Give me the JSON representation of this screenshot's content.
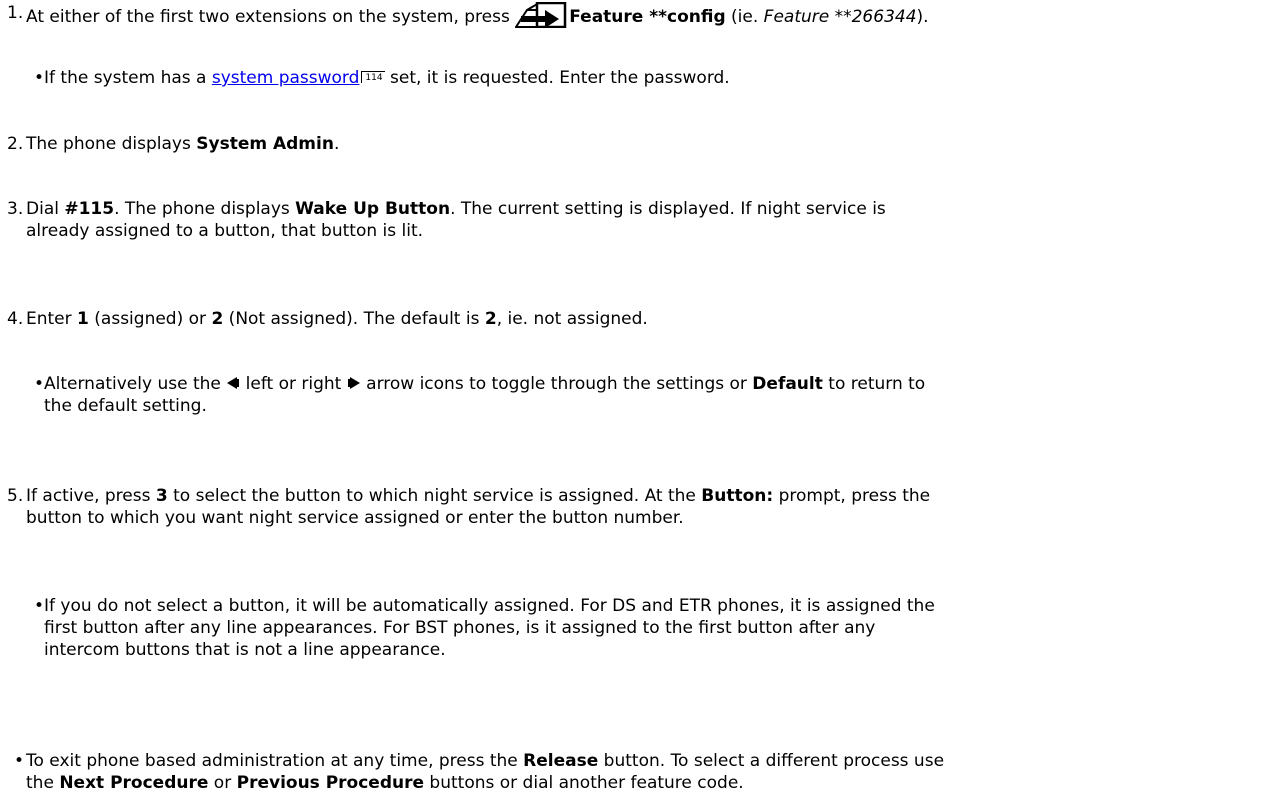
{
  "step1": {
    "num": "1.",
    "text_a": "At either of the first two extensions on the system, press ",
    "feature_label": "Feature **config",
    "text_b": " (ie. ",
    "feature_code": "Feature **266344",
    "text_c": ")."
  },
  "step1_sub": {
    "text_a": "If the system has a ",
    "link": "system password",
    "page_ref": "114",
    "text_b": " set, it is requested. Enter the password."
  },
  "step2": {
    "num": "2.",
    "text_a": "The phone displays ",
    "display": "System Admin",
    "text_b": "."
  },
  "step3": {
    "num": "3.",
    "text_a": "Dial ",
    "code": "#115",
    "text_b": ". The phone displays ",
    "display": "Wake Up Button",
    "text_c": ". The current setting is displayed. If night service is",
    "line2": "already assigned to a button, that button is lit."
  },
  "step4": {
    "num": "4.",
    "text_a": "Enter ",
    "opt1": "1",
    "text_b": " (assigned) or ",
    "opt2": "2",
    "text_c": " (Not assigned). The default is ",
    "default_val": "2",
    "text_d": ", ie. not assigned."
  },
  "step4_sub": {
    "text_a": "Alternatively use the ",
    "text_b": " left or right ",
    "text_c": " arrow icons to toggle through the settings or ",
    "default_label": "Default",
    "text_d": " to return to",
    "line2": "the default setting."
  },
  "step5": {
    "num": "5.",
    "text_a": "If active, press ",
    "key": "3",
    "text_b": " to select the button to which night service is assigned. At the ",
    "prompt": "Button:",
    "text_c": " prompt, press the",
    "line2": "button to which you want night service assigned or enter the button number."
  },
  "step5_sub": {
    "line1": "If you do not select a button, it will be automatically assigned. For DS and ETR phones, it is assigned the",
    "line2": "first button after any line appearances. For BST phones, is it assigned to the first button after any",
    "line3": "intercom buttons that is not a line appearance."
  },
  "footer": {
    "text_a": "To exit phone based administration at any time, press the ",
    "release": "Release",
    "text_b": " button. To select a different process use",
    "text_c": "the ",
    "next": "Next Procedure",
    "text_d": " or ",
    "prev": "Previous Procedure",
    "text_e": " buttons or dial another feature code."
  },
  "icons": {
    "feature": "feature-button-icon",
    "left": "left-arrow-icon",
    "right": "right-arrow-icon"
  }
}
